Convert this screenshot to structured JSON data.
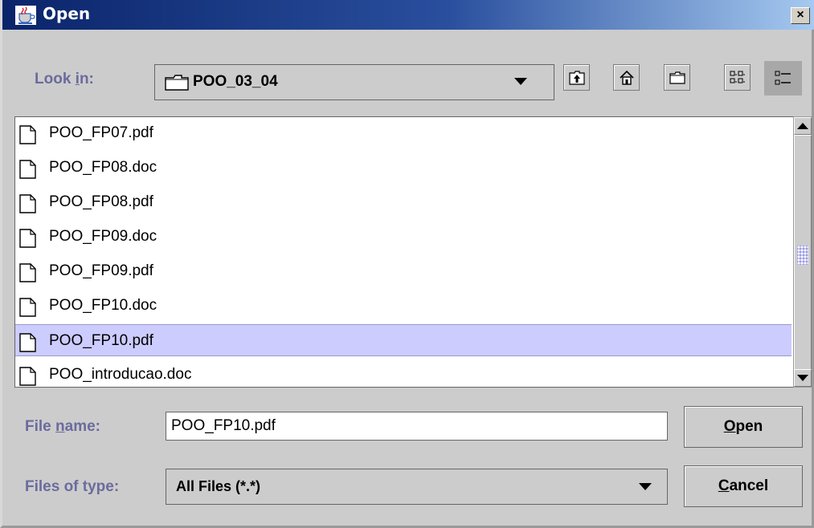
{
  "window": {
    "title": "Open",
    "close_glyph": "×",
    "app_icon": "java-cup-icon"
  },
  "look_in": {
    "label_pre": "Look ",
    "label_mn": "i",
    "label_post": "n:",
    "value": "POO_03_04",
    "folder_icon": "folder-icon"
  },
  "toolbar": {
    "buttons": [
      {
        "name": "up-one-level-icon"
      },
      {
        "name": "home-icon"
      },
      {
        "name": "new-folder-icon"
      },
      {
        "name": "list-view-icon"
      },
      {
        "name": "details-view-icon",
        "pressed": true
      }
    ]
  },
  "files": [
    {
      "name": "POO_FP07.pdf"
    },
    {
      "name": "POO_FP08.doc"
    },
    {
      "name": "POO_FP08.pdf"
    },
    {
      "name": "POO_FP09.doc"
    },
    {
      "name": "POO_FP09.pdf"
    },
    {
      "name": "POO_FP10.doc"
    },
    {
      "name": "POO_FP10.pdf",
      "selected": true
    },
    {
      "name": "POO_introducao.doc"
    }
  ],
  "file_name": {
    "label_pre": "File ",
    "label_mn": "n",
    "label_post": "ame:",
    "value": "POO_FP10.pdf"
  },
  "files_of_type": {
    "label": "Files of type:",
    "value": "All Files (*.*)"
  },
  "buttons": {
    "open_mn": "O",
    "open_rest": "pen",
    "cancel_mn": "C",
    "cancel_rest": "ancel"
  },
  "colors": {
    "title_gradient_start": "#0a246a",
    "title_gradient_end": "#a6caf0",
    "label_color": "#6b6b9e",
    "selection_bg": "#ccccff",
    "panel_bg": "#cccccc"
  }
}
